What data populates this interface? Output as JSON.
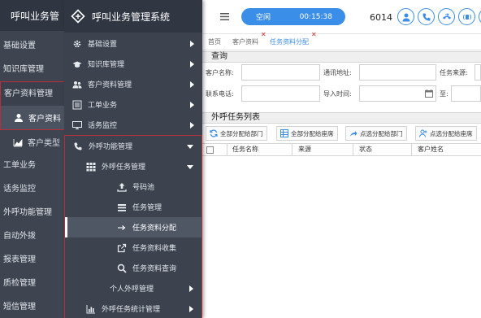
{
  "app": {
    "title_bg": "呼叫业务管",
    "title": "呼叫业务管理系统"
  },
  "bg_sidebar": {
    "items": [
      "基础设置",
      "知识库管理",
      "客户资料管理"
    ],
    "sub_items": [
      "客户资料",
      "客户类型"
    ],
    "items2": [
      "工单业务",
      "话务监控",
      "外呼功能管理",
      "自动外拨",
      "报表管理",
      "质检管理",
      "短信管理"
    ]
  },
  "menu": {
    "items": [
      {
        "label": "基础设置",
        "icon": "gear-icon"
      },
      {
        "label": "知识库管理",
        "icon": "graduation-cap-icon"
      },
      {
        "label": "客户资料管理",
        "icon": "users-icon"
      },
      {
        "label": "工单业务",
        "icon": "list-icon"
      },
      {
        "label": "话务监控",
        "icon": "monitor-icon"
      }
    ],
    "outbound": {
      "label": "外呼功能管理",
      "task_mgmt": "外呼任务管理",
      "children": [
        {
          "label": "号码池",
          "icon": "upload-icon"
        },
        {
          "label": "任务管理",
          "icon": "list-alt-icon"
        },
        {
          "label": "任务资料分配",
          "icon": "arrow-right-icon"
        },
        {
          "label": "任务资料收集",
          "icon": "external-link-icon"
        },
        {
          "label": "任务资料查询",
          "icon": "search-icon"
        }
      ],
      "personal": "个人外呼管理",
      "stats": "外呼任务统计管理"
    }
  },
  "topbar": {
    "status": "空闲",
    "timer": "00:15:38",
    "extension": "6014"
  },
  "tabs": [
    "首页",
    "客户资料",
    "任务资料分配"
  ],
  "query": {
    "title": "查询",
    "customer_name_label": "客户名称:",
    "address_label": "通讯地址:",
    "source_label": "任务来源:",
    "phone_label": "联系电话:",
    "import_time_label": "导入时间:",
    "to_label": "至:"
  },
  "task_list": {
    "title": "外呼任务列表",
    "buttons": [
      "全部分配给部门",
      "全部分配给座席",
      "点选分配给部门",
      "点选分配给座席"
    ],
    "columns": [
      "任务名称",
      "来源",
      "状态",
      "客户姓名"
    ]
  },
  "colors": {
    "accent": "#3b8ee8",
    "sidebar": "#3c434f",
    "highlight_border": "#b5303b",
    "close": "#d82525"
  }
}
